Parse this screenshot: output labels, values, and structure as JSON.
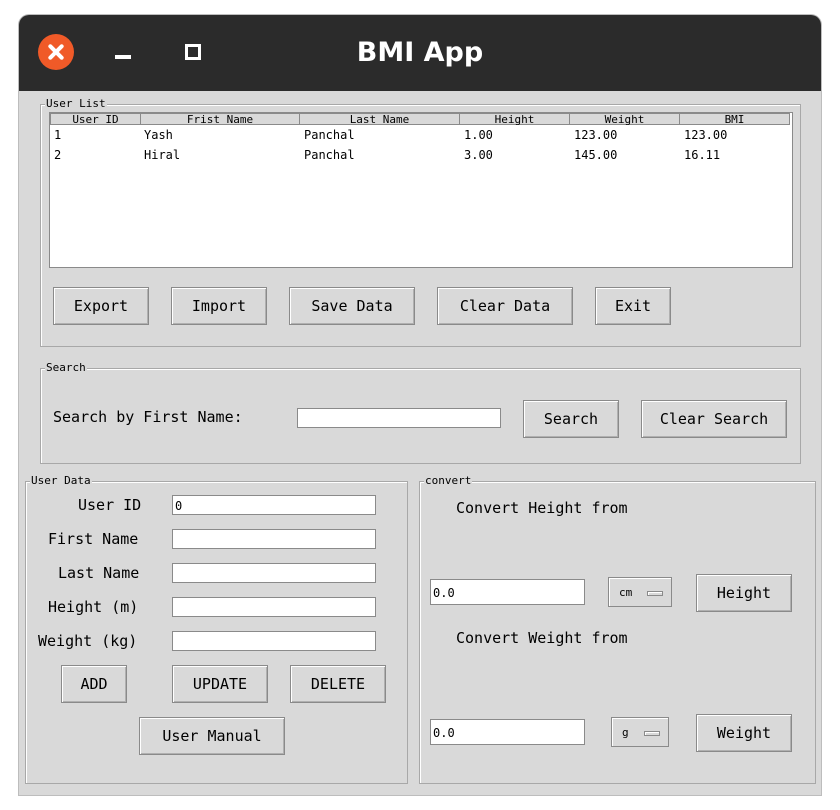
{
  "window": {
    "title": "BMI App"
  },
  "user_list": {
    "label": "User List",
    "columns": [
      "User ID",
      "Frist Name",
      "Last Name",
      "Height",
      "Weight",
      "BMI"
    ],
    "rows": [
      [
        "1",
        "Yash",
        "Panchal",
        "1.00",
        "123.00",
        "123.00"
      ],
      [
        "2",
        "Hiral",
        "Panchal",
        "3.00",
        "145.00",
        "16.11"
      ]
    ],
    "buttons": {
      "export": "Export",
      "import": "Import",
      "save": "Save Data",
      "clear": "Clear Data",
      "exit": "Exit"
    }
  },
  "search": {
    "label": "Search",
    "prompt": "Search by First Name:",
    "value": "",
    "search_button": "Search",
    "clear_button": "Clear Search"
  },
  "user_data": {
    "label": "User Data",
    "fields": {
      "user_id": {
        "label": "User ID",
        "value": "0"
      },
      "first_name": {
        "label": "First Name",
        "value": ""
      },
      "last_name": {
        "label": "Last Name",
        "value": ""
      },
      "height": {
        "label": "Height (m)",
        "value": ""
      },
      "weight": {
        "label": "Weight (kg)",
        "value": ""
      }
    },
    "buttons": {
      "add": "ADD",
      "update": "UPDATE",
      "delete": "DELETE",
      "manual": "User Manual"
    }
  },
  "convert": {
    "label": "convert",
    "height_title": "Convert Height from",
    "height_value": "0.0",
    "height_unit": "cm",
    "height_button": "Height",
    "weight_title": "Convert Weight from",
    "weight_value": "0.0",
    "weight_unit": "g",
    "weight_button": "Weight"
  },
  "colors": {
    "titlebar": "#2b2b2b",
    "close": "#f05a28",
    "background": "#d9d9d9"
  }
}
